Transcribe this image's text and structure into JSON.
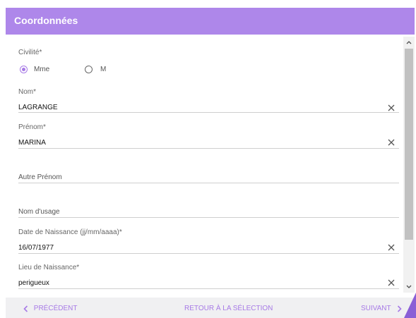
{
  "header": {
    "title": "Coordonnées"
  },
  "form": {
    "civilite": {
      "label": "Civilité*",
      "options": [
        {
          "label": "Mme",
          "selected": true
        },
        {
          "label": "M",
          "selected": false
        }
      ]
    },
    "nom": {
      "label": "Nom*",
      "value": "LAGRANGE"
    },
    "prenom": {
      "label": "Prénom*",
      "value": "MARINA"
    },
    "autre_prenom": {
      "placeholder": "Autre Prénom"
    },
    "nom_usage": {
      "placeholder": "Nom d'usage"
    },
    "date_naissance": {
      "label": "Date de Naissance (jj/mm/aaaa)*",
      "value": "16/07/1977"
    },
    "lieu_naissance": {
      "label": "Lieu de Naissance*",
      "value": "perigueux"
    }
  },
  "footer": {
    "previous_label": "PRÉCÉDENT",
    "back_label": "RETOUR À LA SÉLECTION",
    "next_label": "SUIVANT"
  },
  "colors": {
    "accent": "#ae87ea",
    "link": "#a77ae6",
    "footer_bg": "#f0f0f2"
  }
}
